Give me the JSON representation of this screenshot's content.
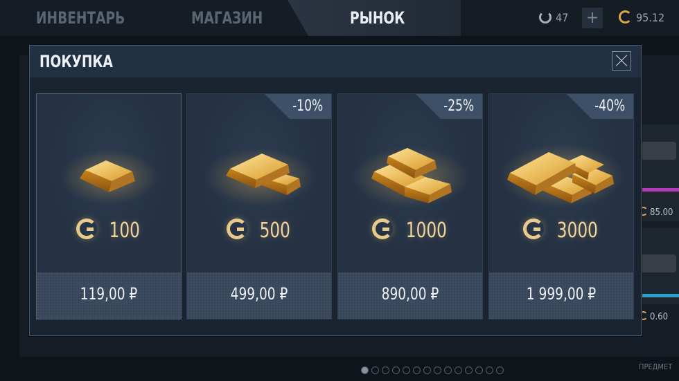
{
  "topbar": {
    "tabs": [
      {
        "label": "ИНВЕНТАРЬ"
      },
      {
        "label": "МАГАЗИН"
      },
      {
        "label": "РЫНОК"
      }
    ],
    "coins": "47",
    "plus": "+",
    "gold": "95.12"
  },
  "background": {
    "price_1": "85.00",
    "price_2": "0.60",
    "footer": "ПРЕДМЕТ"
  },
  "modal": {
    "title": "ПОКУПКА",
    "cards": [
      {
        "discount": "",
        "amount": "100",
        "price": "119,00 ₽"
      },
      {
        "discount": "-10%",
        "amount": "500",
        "price": "499,00 ₽"
      },
      {
        "discount": "-25%",
        "amount": "1000",
        "price": "890,00 ₽"
      },
      {
        "discount": "-40%",
        "amount": "3000",
        "price": "1 999,00 ₽"
      }
    ]
  },
  "pagination": {
    "total": 14,
    "active": 1
  },
  "colors": {
    "gold": "#e9c98c",
    "panel": "#243244",
    "badge": "#3e5068"
  }
}
